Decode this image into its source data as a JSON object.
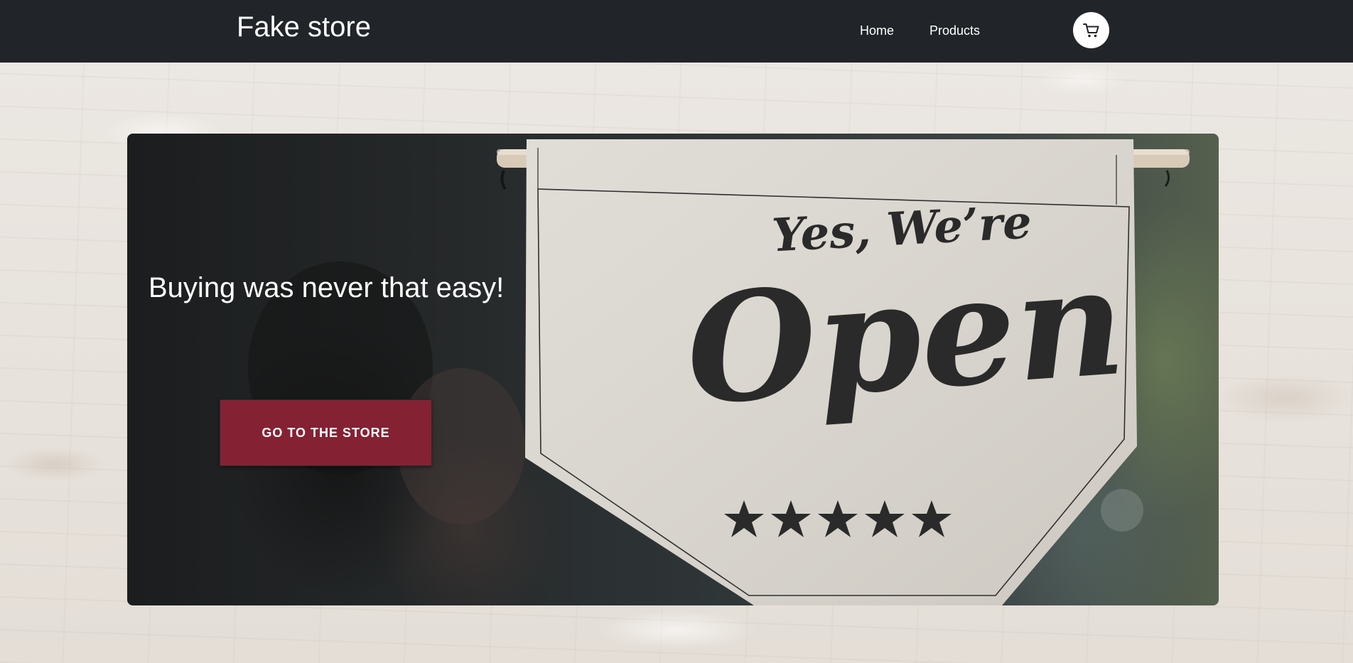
{
  "navbar": {
    "brand": "Fake store",
    "links": [
      {
        "label": "Home"
      },
      {
        "label": "Products"
      }
    ],
    "cart_icon": "cart-icon"
  },
  "hero": {
    "title": "Buying was never that easy!",
    "cta_label": "GO TO THE STORE",
    "banner": {
      "line1": "Yes, We’re",
      "line2": "Open",
      "stars": 5,
      "stars_icon": "star-icon"
    }
  },
  "colors": {
    "navbar_bg": "#212529",
    "cta_bg": "#842133",
    "banner_fabric": "#dcd8d1",
    "banner_ink": "#2a2a2a"
  }
}
